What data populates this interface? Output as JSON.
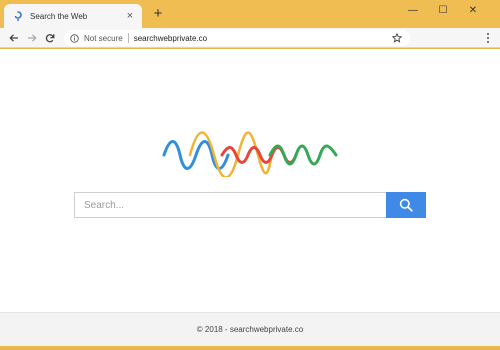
{
  "browser": {
    "tab": {
      "title": "Search the Web",
      "close_glyph": "×",
      "favicon": "swirl-favicon-icon"
    },
    "new_tab_glyph": "+",
    "window_controls": {
      "minimize": "—",
      "maximize": "☐",
      "close": "✕"
    },
    "omnibox": {
      "security_label": "Not secure",
      "url": "searchwebprivate.co"
    },
    "accent_color": "#f0bd52"
  },
  "page": {
    "search": {
      "placeholder": "Search...",
      "button_icon": "magnifier-icon",
      "button_color": "#3f8ae6"
    },
    "footer": {
      "text": "© 2018 - searchwebprivate.co"
    },
    "logo_colors": [
      "#2f8fde",
      "#f2b233",
      "#e8453c",
      "#34a853"
    ]
  }
}
